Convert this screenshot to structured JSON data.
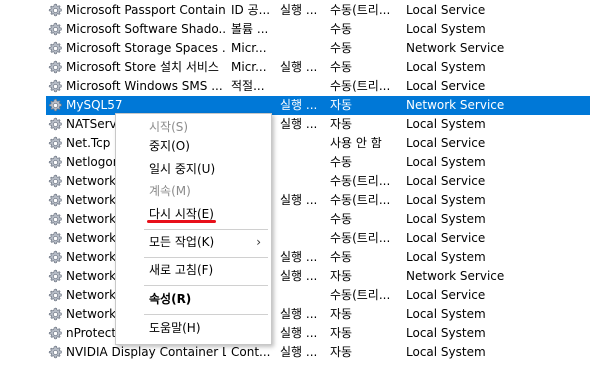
{
  "services": [
    {
      "name": "Microsoft Passport Container",
      "desc": "ID 공...",
      "status": "실행 ...",
      "startup": "수동(트리...",
      "logon": "Local Service"
    },
    {
      "name": "Microsoft Software Shado...",
      "desc": "볼륨 ...",
      "status": "",
      "startup": "수동",
      "logon": "Local System"
    },
    {
      "name": "Microsoft Storage Spaces ...",
      "desc": "Micr...",
      "status": "",
      "startup": "수동",
      "logon": "Network Service"
    },
    {
      "name": "Microsoft Store 설치 서비스",
      "desc": "Micr...",
      "status": "실행 ...",
      "startup": "수동",
      "logon": "Local System"
    },
    {
      "name": "Microsoft Windows SMS ...",
      "desc": "적절...",
      "status": "",
      "startup": "수동(트리...",
      "logon": "Local Service"
    },
    {
      "name": "MySQL57",
      "desc": "",
      "status": "실행 ...",
      "startup": "자동",
      "logon": "Network Service",
      "selected": true
    },
    {
      "name": "NATServ",
      "desc": "",
      "status": "실행 ...",
      "startup": "자동",
      "logon": "Local System"
    },
    {
      "name": "Net.Tcp",
      "desc": "",
      "status": "",
      "startup": "사용 안 함",
      "logon": "Local Service"
    },
    {
      "name": "Netlogon",
      "desc": "",
      "status": "",
      "startup": "수동",
      "logon": "Local System"
    },
    {
      "name": "Network",
      "desc": "",
      "status": "",
      "startup": "수동(트리...",
      "logon": "Local Service"
    },
    {
      "name": "Network",
      "desc": "",
      "status": "실행 ...",
      "startup": "수동(트리...",
      "logon": "Local System"
    },
    {
      "name": "Network",
      "desc": "",
      "status": "",
      "startup": "수동",
      "logon": "Local System"
    },
    {
      "name": "Network",
      "desc": "",
      "status": "",
      "startup": "수동(트리...",
      "logon": "Local Service"
    },
    {
      "name": "Network",
      "desc": "",
      "status": "실행 ...",
      "startup": "수동",
      "logon": "Local System"
    },
    {
      "name": "Network",
      "desc": "",
      "status": "실행 ...",
      "startup": "자동",
      "logon": "Network Service"
    },
    {
      "name": "Network",
      "desc": "",
      "status": "",
      "startup": "수동(트리...",
      "logon": "Local Service"
    },
    {
      "name": "Network",
      "desc": "",
      "status": "실행 ...",
      "startup": "자동",
      "logon": "Local System"
    },
    {
      "name": "nProtect",
      "desc": "",
      "status": "실행 ...",
      "startup": "자동",
      "logon": "Local System"
    },
    {
      "name": "NVIDIA Display Container LS",
      "desc": "Cont...",
      "status": "실행 ...",
      "startup": "자동",
      "logon": "Local System"
    }
  ],
  "context_menu": {
    "items": [
      {
        "label": "시작(S)",
        "disabled": true
      },
      {
        "label": "중지(O)"
      },
      {
        "label": "일시 중지(U)"
      },
      {
        "label": "계속(M)",
        "disabled": true
      },
      {
        "label": "다시 시작(E)",
        "highlighted_underline": true
      },
      {
        "label": "모든 작업(K)",
        "submenu": true
      },
      {
        "label": "새로 고침(F)"
      },
      {
        "label": "속성(R)",
        "bold": true
      },
      {
        "label": "도움말(H)"
      }
    ],
    "submenu_arrow": "›"
  },
  "colors": {
    "selection": "#0078d7",
    "annotation_underline": "#e8101a",
    "disabled_text": "#8c8c8c"
  },
  "icons": {
    "service": "gear-icon"
  }
}
